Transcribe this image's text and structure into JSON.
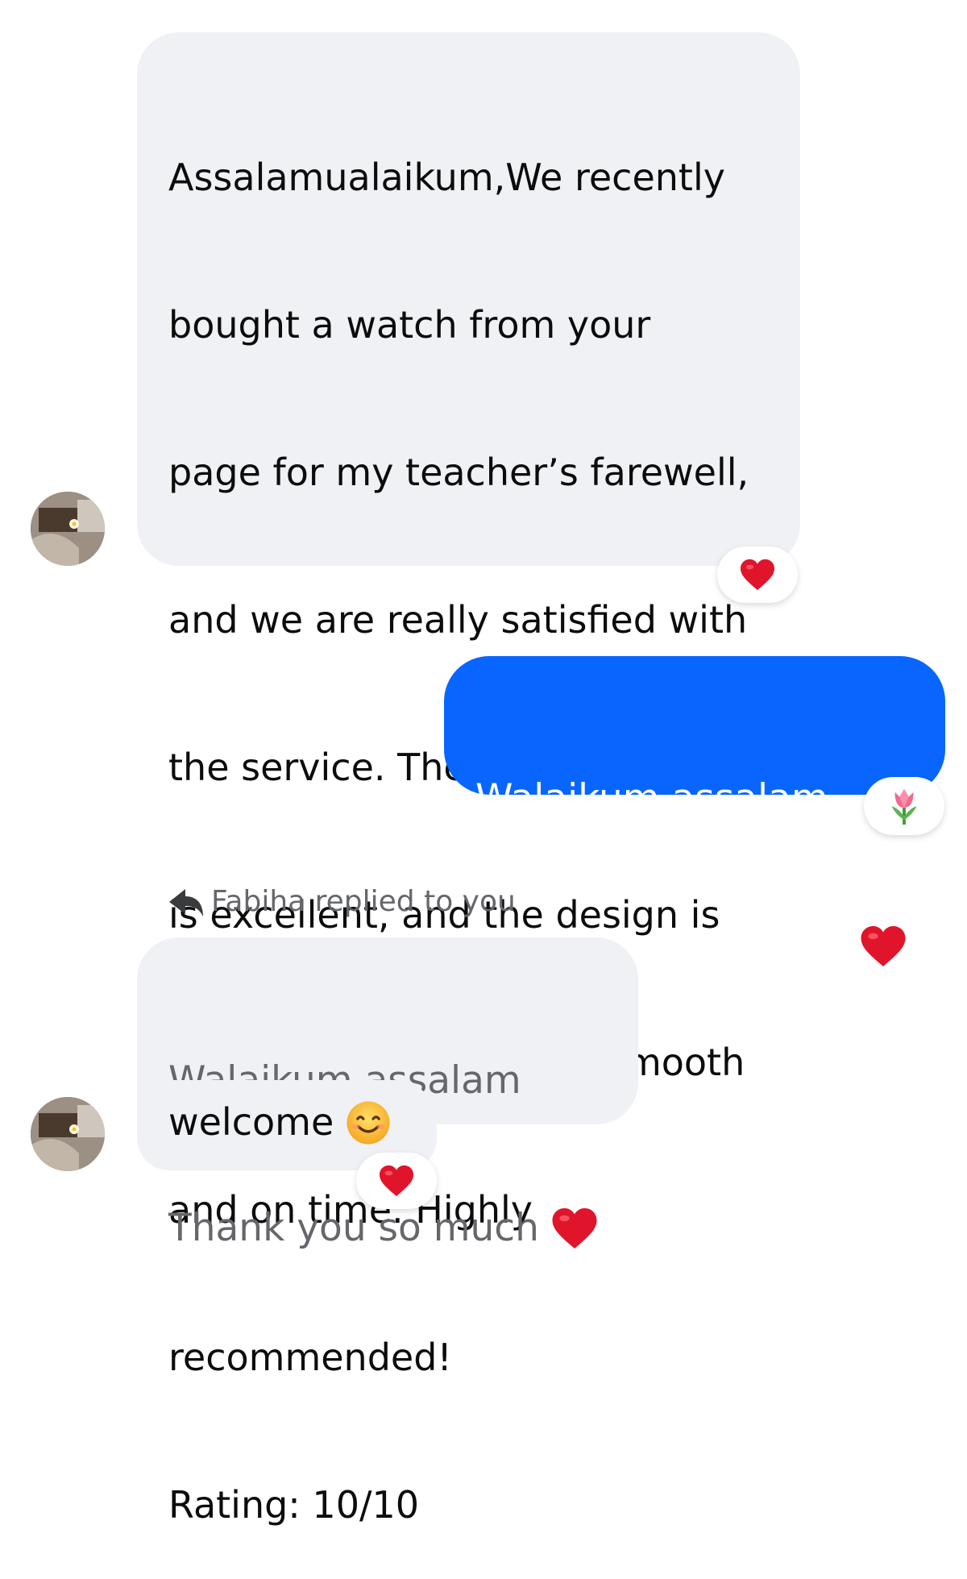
{
  "messages": {
    "first": {
      "lines": [
        "Assalamualaikum,We recently",
        "bought a watch from your",
        "page for my teacher’s farewell,",
        "and we are really satisfied with",
        "the service. The watch quality",
        "is excellent, and the design is",
        "beautiful. Delivery was smooth",
        "and on time. Highly",
        "recommended!",
        "Rating: 10/10"
      ],
      "reaction": "heart-emoji"
    },
    "reply_out": {
      "line1": "Walaikum assalam",
      "line2": "Thank you so much",
      "inline_emoji": "heart-emoji",
      "reaction": "tulip-emoji"
    },
    "reply_in": {
      "header": "Fabiha replied to you",
      "quoted_line1": "Walaikum assalam",
      "quoted_line2": "Thank you so much",
      "text": "welcome",
      "inline_emoji": "smiling-face-emoji",
      "reaction": "heart-emoji"
    }
  },
  "colors": {
    "outgoing_bubble": "#0866ff",
    "incoming_bubble": "#f0f1f5",
    "heart": "#e0142a"
  }
}
